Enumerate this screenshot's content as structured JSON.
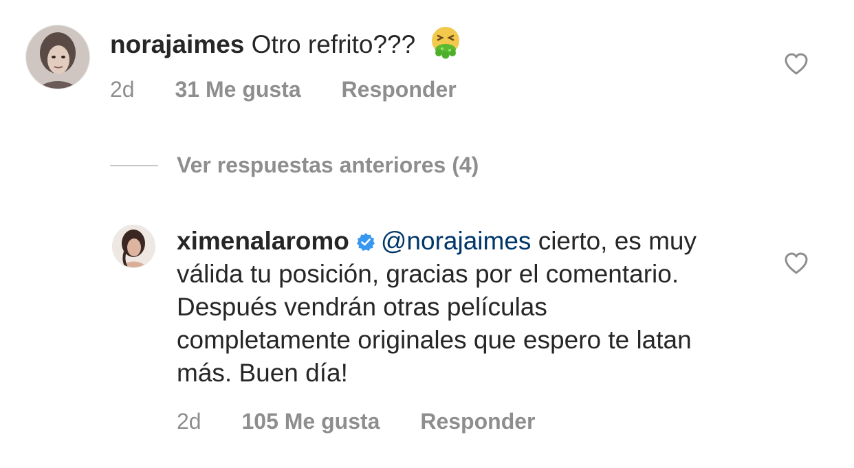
{
  "comment": {
    "username": "norajaimes",
    "text": "Otro refrito???",
    "emoji": "nauseated-face-emoji",
    "time": "2d",
    "likes": "31 Me gusta",
    "reply_label": "Responder"
  },
  "view_replies": {
    "label": "Ver respuestas anteriores (4)"
  },
  "reply": {
    "username": "ximenalaromo",
    "verified_icon": "verified-badge-icon",
    "mention": "@norajaimes",
    "text": "cierto, es muy válida tu posición, gracias por el comentario. Después vendrán otras películas completamente originales que espero te latan más. Buen día!",
    "time": "2d",
    "likes": "105 Me gusta",
    "reply_label": "Responder"
  },
  "colors": {
    "text": "#262626",
    "secondary": "#8e8e8e",
    "mention": "#00376b",
    "verified": "#3897f0"
  }
}
